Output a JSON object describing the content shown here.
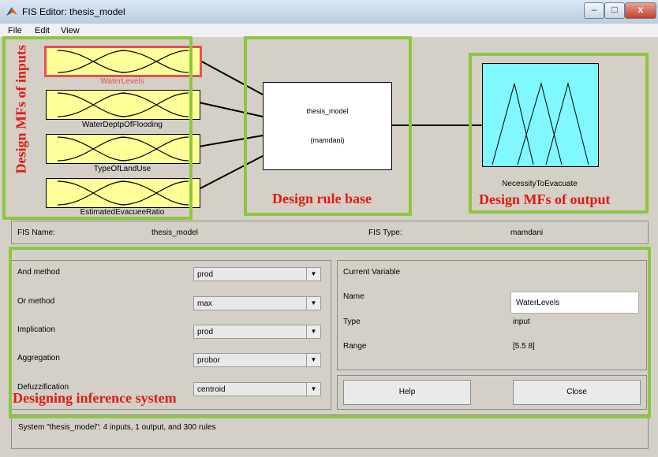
{
  "window": {
    "title": "FIS Editor: thesis_model",
    "minimize": "–",
    "maximize": "□",
    "close": "x"
  },
  "menu": {
    "file": "File",
    "edit": "Edit",
    "view": "View"
  },
  "graphic": {
    "inputs": [
      "WaterLevels",
      "WaterDeptpOfFlooding",
      "TypeOfLandUse",
      "EstimatedEvacueeRatio"
    ],
    "rule_title": "thesis_model",
    "rule_type": "(mamdani)",
    "output": "NecessityToEvacuate"
  },
  "annotations": {
    "inputs": "Design MFs of inputs",
    "rules": "Design rule base",
    "output": "Design MFs of output",
    "inference": "Designing inference system"
  },
  "info": {
    "fis_name_label": "FIS Name:",
    "fis_name": "thesis_model",
    "fis_type_label": "FIS Type:",
    "fis_type": "mamdani"
  },
  "methods": [
    {
      "label": "And method",
      "value": "prod"
    },
    {
      "label": "Or method",
      "value": "max"
    },
    {
      "label": "Implication",
      "value": "prod"
    },
    {
      "label": "Aggregation",
      "value": "probor"
    },
    {
      "label": "Defuzzification",
      "value": "centroid"
    }
  ],
  "variable": {
    "header": "Current Variable",
    "name_label": "Name",
    "name_value": "WaterLevels",
    "type_label": "Type",
    "type_value": "input",
    "range_label": "Range",
    "range_value": "[5.5 8]"
  },
  "buttons": {
    "help": "Help",
    "close": "Close"
  },
  "status": "System \"thesis_model\": 4 inputs, 1 output, and 300 rules",
  "colors": {
    "input_box": "#ffff99",
    "output_box": "#7ff8ff",
    "annotation": "#e01b10",
    "frame": "#8ec63f",
    "selected": "#e55050"
  }
}
